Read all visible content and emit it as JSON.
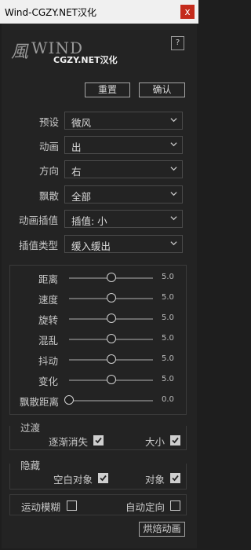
{
  "window": {
    "title": "Wind-CGZY.NET汉化",
    "close_label": "x"
  },
  "logo": {
    "glyph": "風",
    "wordmark": "WIND",
    "subtitle": "CGZY.NET汉化"
  },
  "help": {
    "label": "?"
  },
  "actions": {
    "reset_label": "重置",
    "confirm_label": "确认"
  },
  "dropdowns": [
    {
      "label": "预设",
      "value": "微风"
    },
    {
      "label": "动画",
      "value": "出"
    },
    {
      "label": "方向",
      "value": "右"
    },
    {
      "label": "飘散",
      "value": "全部"
    },
    {
      "label": "动画插值",
      "value": "插值: 小"
    },
    {
      "label": "插值类型",
      "value": "缓入缓出"
    }
  ],
  "sliders": [
    {
      "label": "距离",
      "value": "5.0",
      "fraction": 0.5
    },
    {
      "label": "速度",
      "value": "5.0",
      "fraction": 0.5
    },
    {
      "label": "旋转",
      "value": "5.0",
      "fraction": 0.5
    },
    {
      "label": "混乱",
      "value": "5.0",
      "fraction": 0.5
    },
    {
      "label": "抖动",
      "value": "5.0",
      "fraction": 0.5
    },
    {
      "label": "变化",
      "value": "5.0",
      "fraction": 0.5
    },
    {
      "label": "飘散距离",
      "value": "0.0",
      "fraction": 0.0
    }
  ],
  "transition": {
    "title": "过渡",
    "fade": {
      "label": "逐渐消失",
      "checked": true
    },
    "size": {
      "label": "大小",
      "checked": true
    }
  },
  "hide": {
    "title": "隐藏",
    "null_object": {
      "label": "空白对象",
      "checked": true
    },
    "object": {
      "label": "对象",
      "checked": true
    }
  },
  "options": {
    "motion_blur": {
      "label": "运动模糊",
      "checked": false
    },
    "auto_orient": {
      "label": "自动定向",
      "checked": false
    }
  },
  "bake": {
    "label": "烘焙动画"
  },
  "colors": {
    "title_bar": "#f0f0f0",
    "close": "#c42b1c",
    "panel": "#232323"
  }
}
